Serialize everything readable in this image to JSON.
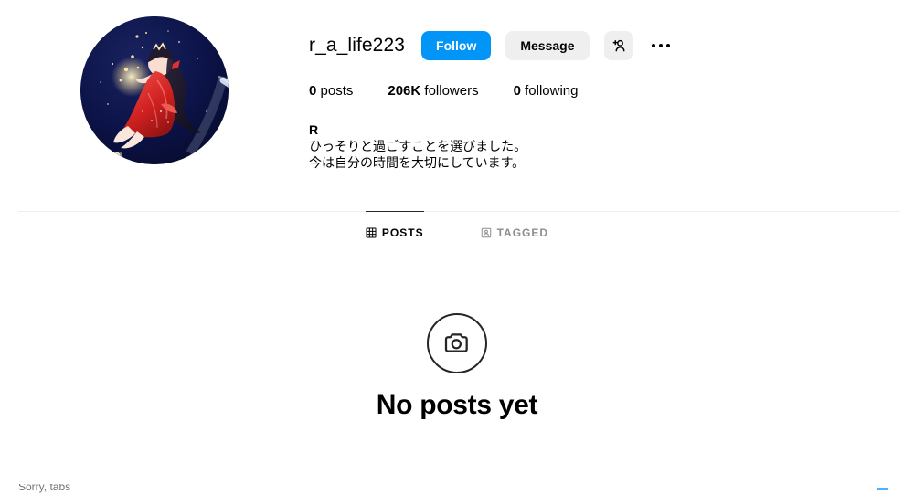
{
  "profile": {
    "username": "r_a_life223",
    "avatar_alt": "anime-girl-on-crescent-moon-avatar",
    "actions": {
      "follow_label": "Follow",
      "message_label": "Message",
      "add_person_icon": "person-add-icon",
      "more_options_icon": "more-options-icon"
    },
    "stats": [
      {
        "value": "0",
        "label": "posts"
      },
      {
        "value": "206K",
        "label": "followers"
      },
      {
        "value": "0",
        "label": "following"
      }
    ],
    "bio": {
      "display_name": "R",
      "lines": [
        "ひっそりと過ごすことを選びました。",
        "今は自分の時間を大切にしています。"
      ]
    }
  },
  "tabs": [
    {
      "label": "POSTS",
      "icon": "grid-icon",
      "active": true
    },
    {
      "label": "TAGGED",
      "icon": "tagged-person-icon",
      "active": false
    }
  ],
  "empty_state": {
    "icon": "camera-icon",
    "title": "No posts yet"
  },
  "footer": {
    "cut_text": "Sorry, tabs"
  },
  "colors": {
    "accent_blue": "#0095f6",
    "button_gray": "#efefef",
    "muted_text": "#8e8e8e",
    "divider": "#efefef",
    "avatar_night": "#0a1040",
    "avatar_dress": "#d32b2b"
  }
}
